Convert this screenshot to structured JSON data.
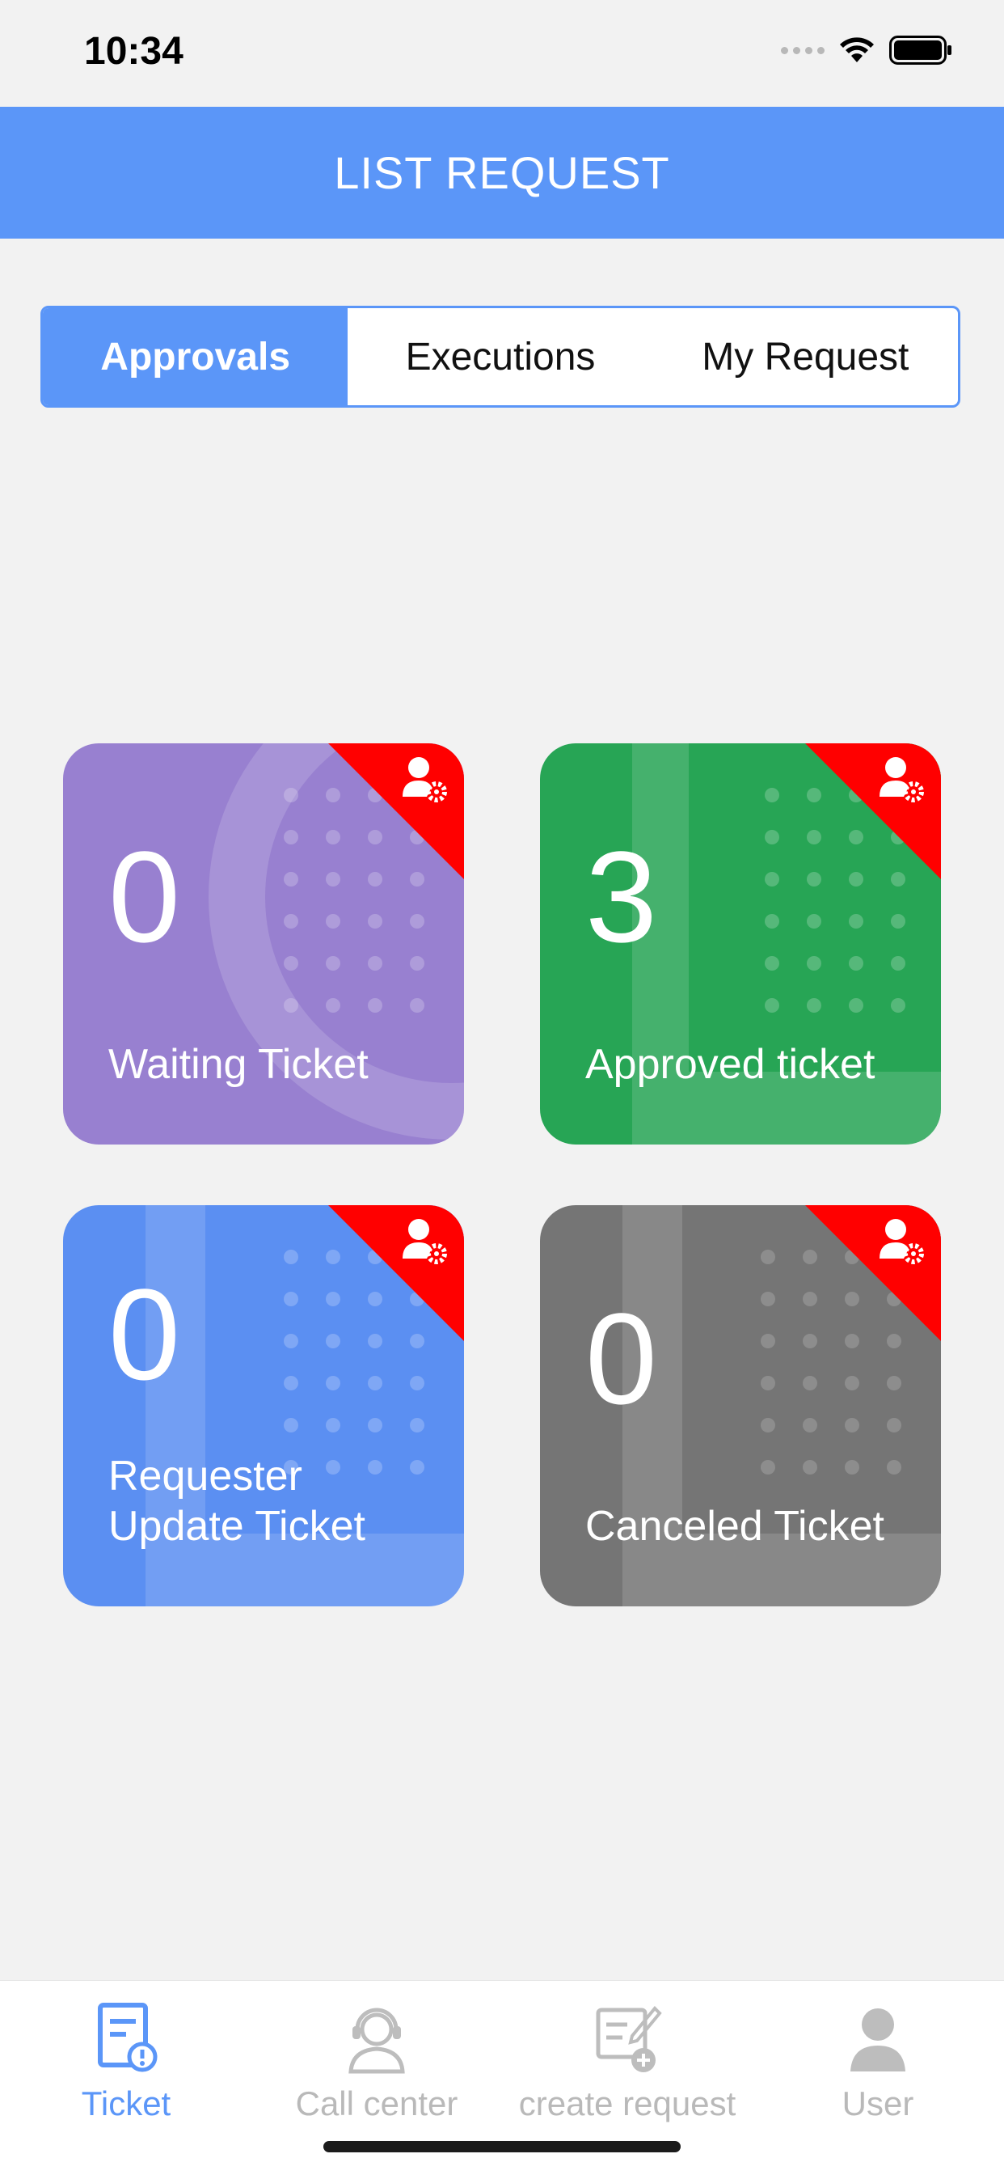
{
  "status_bar": {
    "time": "10:34"
  },
  "header": {
    "title": "LIST REQUEST"
  },
  "tabs": [
    {
      "label": "Approvals",
      "active": true
    },
    {
      "label": "Executions",
      "active": false
    },
    {
      "label": "My Request",
      "active": false
    }
  ],
  "cards": [
    {
      "count": "0",
      "label_line1": "Waiting Ticket",
      "label_line2": "",
      "color": "#9880d0"
    },
    {
      "count": "3",
      "label_line1": "Approved ticket",
      "label_line2": "",
      "color": "#27a555"
    },
    {
      "count": "0",
      "label_line1": "Requester",
      "label_line2": "Update Ticket",
      "color": "#5b8ff2"
    },
    {
      "count": "0",
      "label_line1": "Canceled Ticket",
      "label_line2": "",
      "color": "#757575"
    }
  ],
  "nav": [
    {
      "label": "Ticket",
      "icon": "ticket-icon",
      "active": true
    },
    {
      "label": "Call center",
      "icon": "headset-icon",
      "active": false
    },
    {
      "label": "create request",
      "icon": "create-request-icon",
      "active": false
    },
    {
      "label": "User",
      "icon": "user-icon",
      "active": false
    }
  ],
  "colors": {
    "accent": "#5b96f8",
    "badge_red": "#ff0000"
  }
}
